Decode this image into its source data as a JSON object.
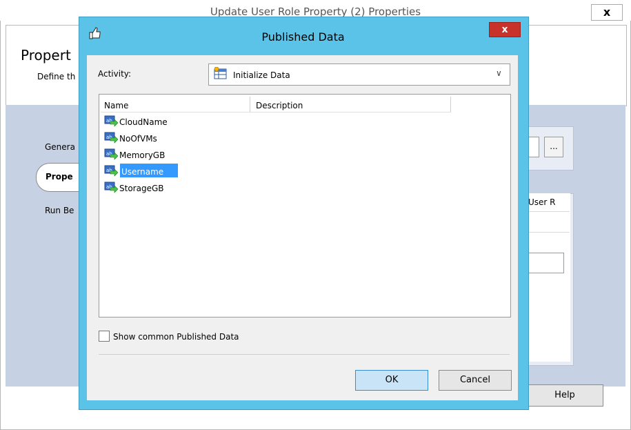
{
  "background_window": {
    "title": "Update User Role Property (2) Properties",
    "close_label": "x",
    "header_title": "Propert",
    "header_subtitle": "Define th",
    "nav": {
      "general": "Genera",
      "properties": "Prope",
      "run_behavior": "Run Be"
    },
    "ellipsis_label": "...",
    "table_header": "User R",
    "help_label": "Help"
  },
  "dialog": {
    "title": "Published Data",
    "close_label": "x",
    "activity_label": "Activity:",
    "activity_value": "Initialize Data",
    "columns": [
      "Name",
      "Description"
    ],
    "items": [
      {
        "name": "CloudName",
        "selected": false
      },
      {
        "name": "NoOfVMs",
        "selected": false
      },
      {
        "name": "MemoryGB",
        "selected": false
      },
      {
        "name": "Username",
        "selected": true
      },
      {
        "name": "StorageGB",
        "selected": false
      }
    ],
    "show_common_label": "Show common Published Data",
    "show_common_checked": false,
    "ok_label": "OK",
    "cancel_label": "Cancel"
  },
  "colors": {
    "dialog_frame": "#5bc3e8",
    "close_button": "#c7332a",
    "selection": "#3399ff",
    "background_body": "#c7d1e4"
  }
}
